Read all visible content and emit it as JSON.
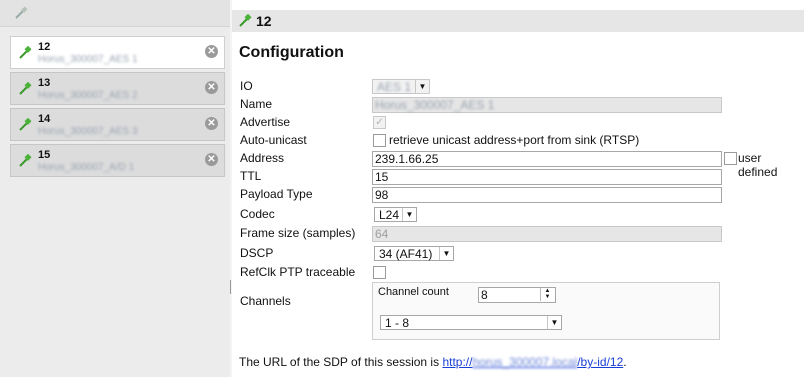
{
  "sidebar": {
    "items": [
      {
        "number": "12",
        "name": "Horus_300007_AES 1",
        "active": true
      },
      {
        "number": "13",
        "name": "Horus_300007_AES 2",
        "active": false
      },
      {
        "number": "14",
        "name": "Horus_300007_AES 3",
        "active": false
      },
      {
        "number": "15",
        "name": "Horus_300007_A/D 1",
        "active": false
      }
    ],
    "close_glyph": "✕"
  },
  "header": {
    "title": "12"
  },
  "config": {
    "heading": "Configuration",
    "labels": {
      "io": "IO",
      "name": "Name",
      "advertise": "Advertise",
      "auto_unicast": "Auto-unicast",
      "address": "Address",
      "ttl": "TTL",
      "payload_type": "Payload Type",
      "codec": "Codec",
      "frame_size": "Frame size (samples)",
      "dscp": "DSCP",
      "refclk": "RefClk PTP traceable",
      "channels": "Channels"
    },
    "io_value": "AES 1",
    "name_value": "Horus_300007_AES 1",
    "advertise_checked": "✓",
    "auto_unicast_text": "retrieve unicast address+port from sink (RTSP)",
    "address_value": "239.1.66.25",
    "user_defined_text": "user defined",
    "ttl_value": "15",
    "payload_type_value": "98",
    "codec_value": "L24",
    "frame_size_value": "64",
    "dscp_value": "34 (AF41)",
    "channel_count_label": "Channel count",
    "channel_count_value": "8",
    "channel_range_value": "1 - 8"
  },
  "footer": {
    "prefix": "The URL of the SDP of this session is ",
    "link_start": "http://",
    "link_host": "horus_300007.local",
    "link_end": "/by-id/12",
    "suffix": "."
  }
}
